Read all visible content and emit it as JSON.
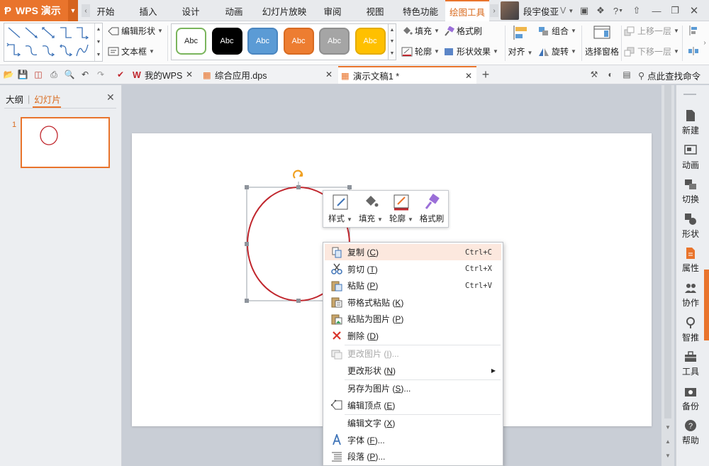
{
  "app": {
    "logo_text": "WPS 演示",
    "accent_color": "#e9742c"
  },
  "menu_tabs": [
    {
      "label": "开始"
    },
    {
      "label": "插入"
    },
    {
      "label": "设计"
    },
    {
      "label": "动画"
    },
    {
      "label": "幻灯片放映"
    },
    {
      "label": "审阅"
    },
    {
      "label": "视图"
    },
    {
      "label": "特色功能"
    },
    {
      "label": "绘图工具",
      "active": true
    }
  ],
  "user": {
    "name": "段宇俊亚",
    "badge": "V"
  },
  "ribbon": {
    "edit_shape_label": "编辑形状",
    "textbox_label": "文本框",
    "style_swatches": [
      {
        "text": "Abc",
        "bg": "#ffffff",
        "border": "#7ab55c",
        "fg": "#222222"
      },
      {
        "text": "Abc",
        "bg": "#000000",
        "border": "#000000",
        "fg": "#ffffff"
      },
      {
        "text": "Abc",
        "bg": "#5b9bd5",
        "border": "#4a86c0",
        "fg": "#ffffff"
      },
      {
        "text": "Abc",
        "bg": "#ed7d31",
        "border": "#d86b22",
        "fg": "#ffffff"
      },
      {
        "text": "Abc",
        "bg": "#a5a5a5",
        "border": "#8f8f8f",
        "fg": "#ffffff"
      },
      {
        "text": "Abc",
        "bg": "#ffc000",
        "border": "#e4ac00",
        "fg": "#ffffff"
      }
    ],
    "fill_label": "填充",
    "format_painter_label": "格式刷",
    "outline_label": "轮廓",
    "shape_effect_label": "形状效果",
    "align_label": "对齐",
    "group_label": "组合",
    "rotate_label": "旋转",
    "selection_pane_label": "选择窗格",
    "bring_forward_label": "上移一层",
    "send_backward_label": "下移一层"
  },
  "doc_tabs": [
    {
      "label": "我的WPS"
    },
    {
      "label": "综合应用.dps"
    },
    {
      "label": "演示文稿1 *",
      "active": true
    }
  ],
  "search_command_label": "点此查找命令",
  "left_panel": {
    "outline_tab": "大纲",
    "slides_tab": "幻灯片",
    "slide_number": "1"
  },
  "mini_toolbar": [
    {
      "label": "样式",
      "icon": "style-icon"
    },
    {
      "label": "填充",
      "icon": "fill-bucket-icon"
    },
    {
      "label": "轮廓",
      "icon": "outline-pen-icon"
    },
    {
      "label": "格式刷",
      "icon": "format-brush-icon"
    }
  ],
  "context_menu": [
    {
      "label": "复制",
      "key": "C",
      "shortcut": "Ctrl+C",
      "icon": "copy-icon",
      "highlighted": true
    },
    {
      "label": "剪切",
      "key": "T",
      "shortcut": "Ctrl+X",
      "icon": "scissors-icon"
    },
    {
      "label": "粘贴",
      "key": "P",
      "shortcut": "Ctrl+V",
      "icon": "paste-icon"
    },
    {
      "label": "带格式粘贴",
      "key": "K",
      "icon": "paste-format-icon"
    },
    {
      "label": "粘贴为图片",
      "key": "P",
      "icon": "paste-picture-icon"
    },
    {
      "label": "删除",
      "key": "D",
      "icon": "delete-icon"
    },
    {
      "label": "更改图片",
      "key": "I",
      "suffix": "...",
      "icon": "change-picture-icon",
      "disabled": true
    },
    {
      "label": "更改形状",
      "key": "N",
      "submenu": true
    },
    {
      "label": "另存为图片",
      "key": "S",
      "suffix": "..."
    },
    {
      "label": "编辑顶点",
      "key": "E",
      "icon": "edit-points-icon"
    },
    {
      "label": "编辑文字",
      "key": "X"
    },
    {
      "label": "字体",
      "key": "F",
      "suffix": "...",
      "icon": "font-icon"
    },
    {
      "label": "段落",
      "key": "P",
      "suffix": "...",
      "icon": "paragraph-icon"
    }
  ],
  "right_panel": [
    {
      "label": "新建",
      "icon": "new-icon"
    },
    {
      "label": "动画",
      "icon": "animation-icon"
    },
    {
      "label": "切换",
      "icon": "transition-icon"
    },
    {
      "label": "形状",
      "icon": "shape-icon"
    },
    {
      "label": "属性",
      "icon": "properties-icon"
    },
    {
      "label": "协作",
      "icon": "collaborate-icon"
    },
    {
      "label": "智推",
      "icon": "smart-push-icon"
    },
    {
      "label": "工具",
      "icon": "tools-icon"
    },
    {
      "label": "备份",
      "icon": "backup-icon"
    },
    {
      "label": "帮助",
      "icon": "help-icon"
    }
  ]
}
